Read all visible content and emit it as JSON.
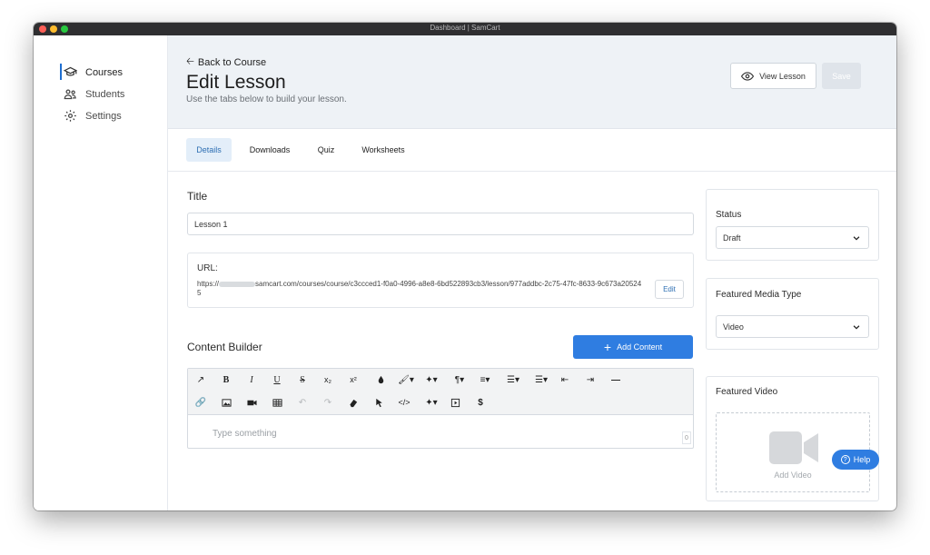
{
  "window": {
    "title": "Dashboard | SamCart"
  },
  "sidebar": {
    "items": [
      {
        "label": "Courses",
        "icon": "graduation-cap-icon",
        "active": true
      },
      {
        "label": "Students",
        "icon": "users-icon"
      },
      {
        "label": "Settings",
        "icon": "gear-icon"
      }
    ]
  },
  "header": {
    "back_label": "Back to Course",
    "title": "Edit Lesson",
    "subtitle": "Use the tabs below to build your lesson.",
    "view_lesson_label": "View Lesson",
    "save_label": "Save"
  },
  "tabs": [
    {
      "label": "Details",
      "active": true
    },
    {
      "label": "Downloads"
    },
    {
      "label": "Quiz"
    },
    {
      "label": "Worksheets"
    }
  ],
  "form": {
    "title_label": "Title",
    "title_value": "Lesson 1",
    "url_label": "URL:",
    "url_prefix": "https://",
    "url_rest": "samcart.com/courses/course/c3ccced1-f0a0-4996-a8e8-6bd522893cb3/lesson/977addbc-2c75-47fc-8633-9c673a205245",
    "edit_label": "Edit",
    "content_builder_label": "Content Builder",
    "add_content_label": "Add Content",
    "editor_placeholder": "Type something",
    "char_count": "0"
  },
  "side_panel": {
    "status_label": "Status",
    "status_value": "Draft",
    "media_type_label": "Featured Media Type",
    "media_type_value": "Video",
    "featured_video_label": "Featured Video",
    "add_video_label": "Add Video"
  },
  "help_label": "Help",
  "colors": {
    "accent": "#2f7de1",
    "header_bg": "#eef2f6",
    "active_tab_bg": "#e3eef9"
  }
}
